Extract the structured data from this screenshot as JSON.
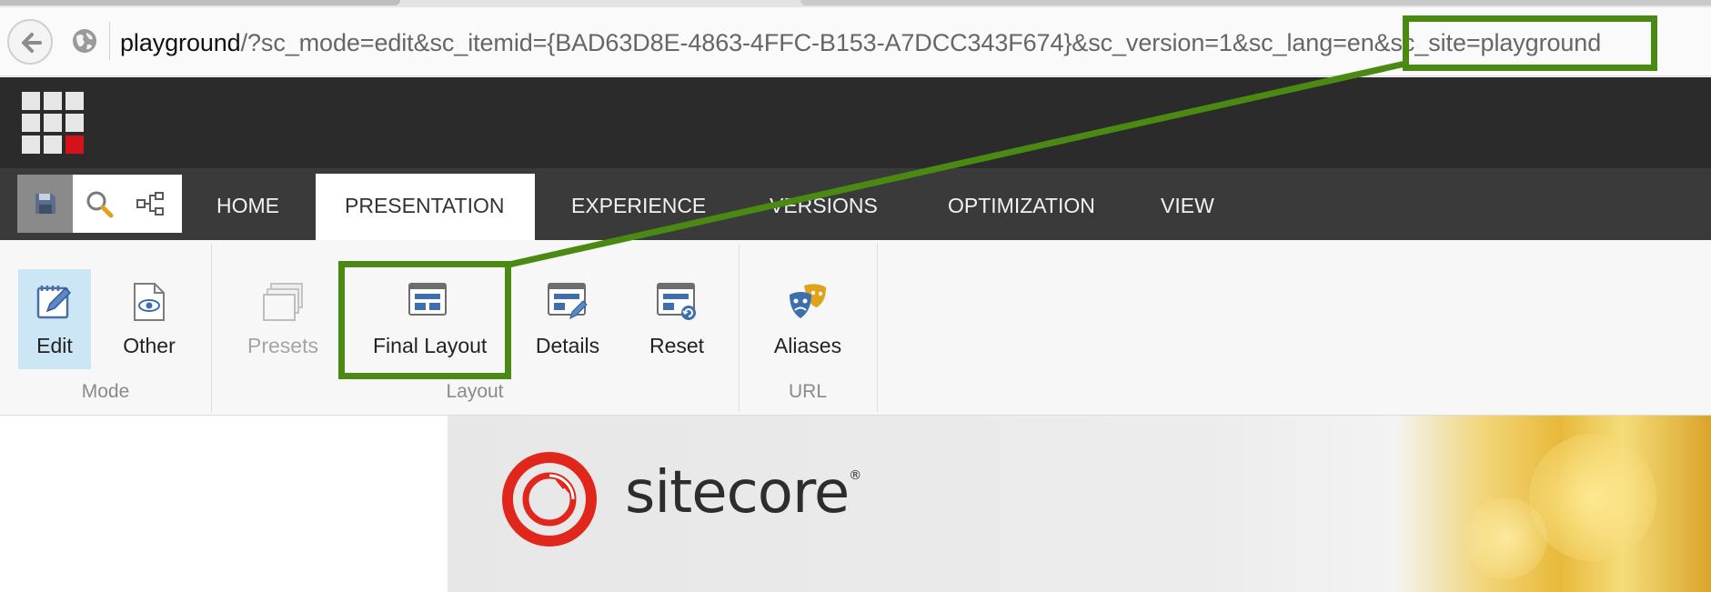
{
  "browser": {
    "url_host": "playground",
    "url_rest": "/?sc_mode=edit&sc_itemid={BAD63D8E-4863-4FFC-B153-A7DCC343F674}&sc_version=1&sc_lang=en&sc_site=playground"
  },
  "ribbon_tabs": [
    {
      "label": "HOME",
      "active": false
    },
    {
      "label": "PRESENTATION",
      "active": true
    },
    {
      "label": "EXPERIENCE",
      "active": false
    },
    {
      "label": "VERSIONS",
      "active": false
    },
    {
      "label": "OPTIMIZATION",
      "active": false
    },
    {
      "label": "VIEW",
      "active": false
    }
  ],
  "ribbon": {
    "mode": {
      "label": "Mode",
      "edit_label": "Edit",
      "other_label": "Other"
    },
    "layout": {
      "label": "Layout",
      "presets_label": "Presets",
      "final_layout_label": "Final Layout",
      "details_label": "Details",
      "reset_label": "Reset"
    },
    "url": {
      "label": "URL",
      "aliases_label": "Aliases"
    }
  },
  "content": {
    "logo_text": "sitecore",
    "logo_reg": "®"
  },
  "colors": {
    "annotation_green": "#4a8a12",
    "header_dark": "#2b2b2b",
    "tabs_dark": "#3a3a3a",
    "logo_red": "#e1261c",
    "selected_blue": "#cde6f5"
  },
  "icons": {
    "back": "back-arrow-icon",
    "globe": "globe-icon",
    "launchpad": "launchpad-grid-icon",
    "save": "save-icon",
    "search": "search-icon",
    "tree": "navigation-tree-icon",
    "edit": "edit-pencil-icon",
    "other": "preview-eye-icon",
    "presets": "presets-icon",
    "final_layout": "final-layout-icon",
    "details": "layout-details-icon",
    "reset": "reset-layout-icon",
    "aliases": "aliases-masks-icon"
  }
}
